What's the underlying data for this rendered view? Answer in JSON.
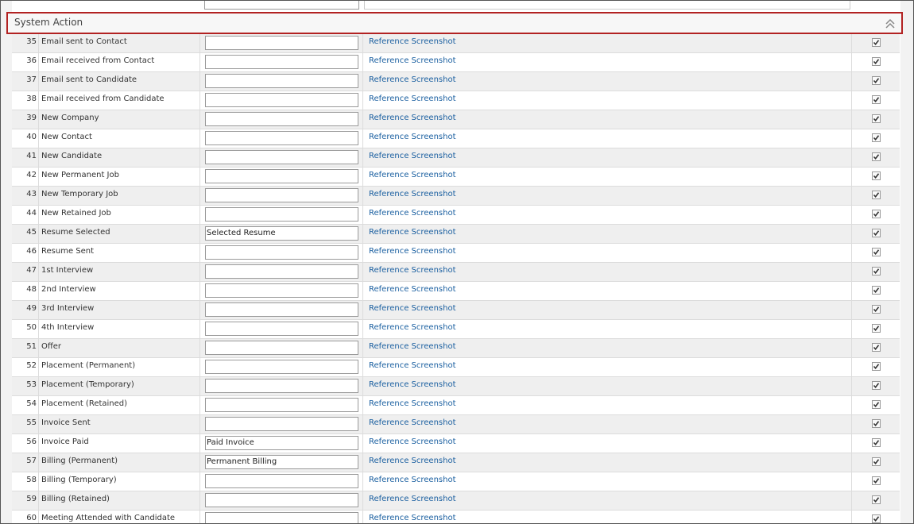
{
  "section": {
    "title": "System Action"
  },
  "rows": [
    {
      "num": "35",
      "name": "Email sent to Contact",
      "value": "",
      "link": "Reference Screenshot"
    },
    {
      "num": "36",
      "name": "Email received from Contact",
      "value": "",
      "link": "Reference Screenshot"
    },
    {
      "num": "37",
      "name": "Email sent to Candidate",
      "value": "",
      "link": "Reference Screenshot"
    },
    {
      "num": "38",
      "name": "Email received from Candidate",
      "value": "",
      "link": "Reference Screenshot"
    },
    {
      "num": "39",
      "name": "New Company",
      "value": "",
      "link": "Reference Screenshot"
    },
    {
      "num": "40",
      "name": "New Contact",
      "value": "",
      "link": "Reference Screenshot"
    },
    {
      "num": "41",
      "name": "New Candidate",
      "value": "",
      "link": "Reference Screenshot"
    },
    {
      "num": "42",
      "name": "New Permanent Job",
      "value": "",
      "link": "Reference Screenshot"
    },
    {
      "num": "43",
      "name": "New Temporary Job",
      "value": "",
      "link": "Reference Screenshot"
    },
    {
      "num": "44",
      "name": "New Retained Job",
      "value": "",
      "link": "Reference Screenshot"
    },
    {
      "num": "45",
      "name": "Resume Selected",
      "value": "Selected Resume",
      "link": "Reference Screenshot"
    },
    {
      "num": "46",
      "name": "Resume Sent",
      "value": "",
      "link": "Reference Screenshot"
    },
    {
      "num": "47",
      "name": "1st Interview",
      "value": "",
      "link": "Reference Screenshot"
    },
    {
      "num": "48",
      "name": "2nd Interview",
      "value": "",
      "link": "Reference Screenshot"
    },
    {
      "num": "49",
      "name": "3rd Interview",
      "value": "",
      "link": "Reference Screenshot"
    },
    {
      "num": "50",
      "name": "4th Interview",
      "value": "",
      "link": "Reference Screenshot"
    },
    {
      "num": "51",
      "name": "Offer",
      "value": "",
      "link": "Reference Screenshot"
    },
    {
      "num": "52",
      "name": "Placement (Permanent)",
      "value": "",
      "link": "Reference Screenshot"
    },
    {
      "num": "53",
      "name": "Placement (Temporary)",
      "value": "",
      "link": "Reference Screenshot"
    },
    {
      "num": "54",
      "name": "Placement (Retained)",
      "value": "",
      "link": "Reference Screenshot"
    },
    {
      "num": "55",
      "name": "Invoice Sent",
      "value": "",
      "link": "Reference Screenshot"
    },
    {
      "num": "56",
      "name": "Invoice Paid",
      "value": "Paid Invoice",
      "link": "Reference Screenshot"
    },
    {
      "num": "57",
      "name": "Billing (Permanent)",
      "value": "Permanent Billing",
      "link": "Reference Screenshot"
    },
    {
      "num": "58",
      "name": "Billing (Temporary)",
      "value": "",
      "link": "Reference Screenshot"
    },
    {
      "num": "59",
      "name": "Billing (Retained)",
      "value": "",
      "link": "Reference Screenshot"
    },
    {
      "num": "60",
      "name": "Meeting Attended with Candidate",
      "value": "",
      "link": "Reference Screenshot"
    }
  ]
}
